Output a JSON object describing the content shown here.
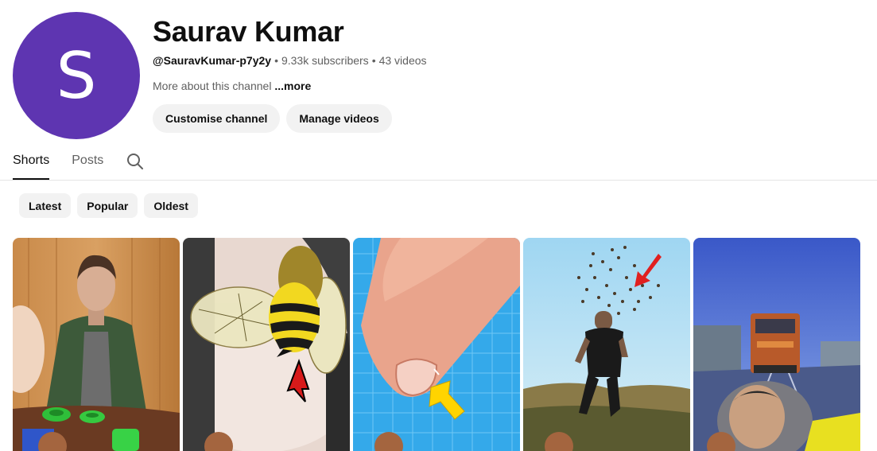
{
  "channel": {
    "avatar_letter": "S",
    "avatar_color": "#5e35b1",
    "name": "Saurav Kumar",
    "handle": "@SauravKumar-p7y2y",
    "separator": "•",
    "subscribers": "9.33k subscribers",
    "videos": "43 videos",
    "about_text": "More about this channel",
    "about_more": "...more"
  },
  "actions": {
    "customise_label": "Customise channel",
    "manage_label": "Manage videos"
  },
  "tabs": [
    {
      "label": "Shorts",
      "active": true
    },
    {
      "label": "Posts",
      "active": false
    }
  ],
  "search_icon": "search-icon",
  "filters": [
    "Latest",
    "Popular",
    "Oldest"
  ],
  "shorts": [
    {
      "thumbnail": "man-at-wooden-table-with-green-rings"
    },
    {
      "thumbnail": "bee-stinger-closeup-with-red-arrow"
    },
    {
      "thumbnail": "finger-nail-closeup-with-yellow-arrow"
    },
    {
      "thumbnail": "man-running-from-insect-swarm"
    },
    {
      "thumbnail": "train-on-tracks-with-man"
    }
  ]
}
